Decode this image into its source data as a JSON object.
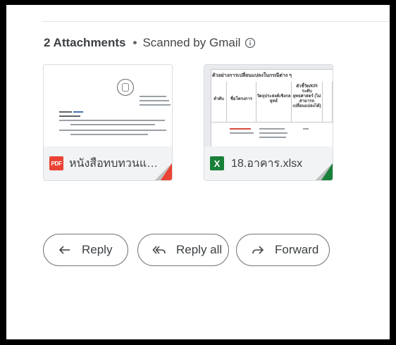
{
  "attachments_header": {
    "count_label": "2 Attachments",
    "separator": "•",
    "scanned_label": "Scanned by Gmail",
    "info_icon": "info-icon"
  },
  "attachments": [
    {
      "type": "pdf",
      "badge": "PDF",
      "name": "หนังสือทบทวนแผน...",
      "icon": "pdf-icon",
      "accent": "#ea4335"
    },
    {
      "type": "xlsx",
      "badge": "X",
      "name": "18.อาคาร.xlsx",
      "icon": "excel-icon",
      "accent": "#188038"
    }
  ],
  "sheet_preview": {
    "title": "ตัวอย่างการเปลี่ยนแปลงในกรณีต่าง ๆ",
    "headers": [
      "ลำดับ",
      "ชื่อโครงการ",
      "วัตถุประสงค์เชิงกลยุทธ์",
      "ตัวชี้วัด/KPI ระดับยุทธศาสตร์ (ไม่สามารถเปลี่ยนแปลงได้)"
    ]
  },
  "actions": {
    "reply": "Reply",
    "reply_all": "Reply all",
    "forward": "Forward"
  }
}
